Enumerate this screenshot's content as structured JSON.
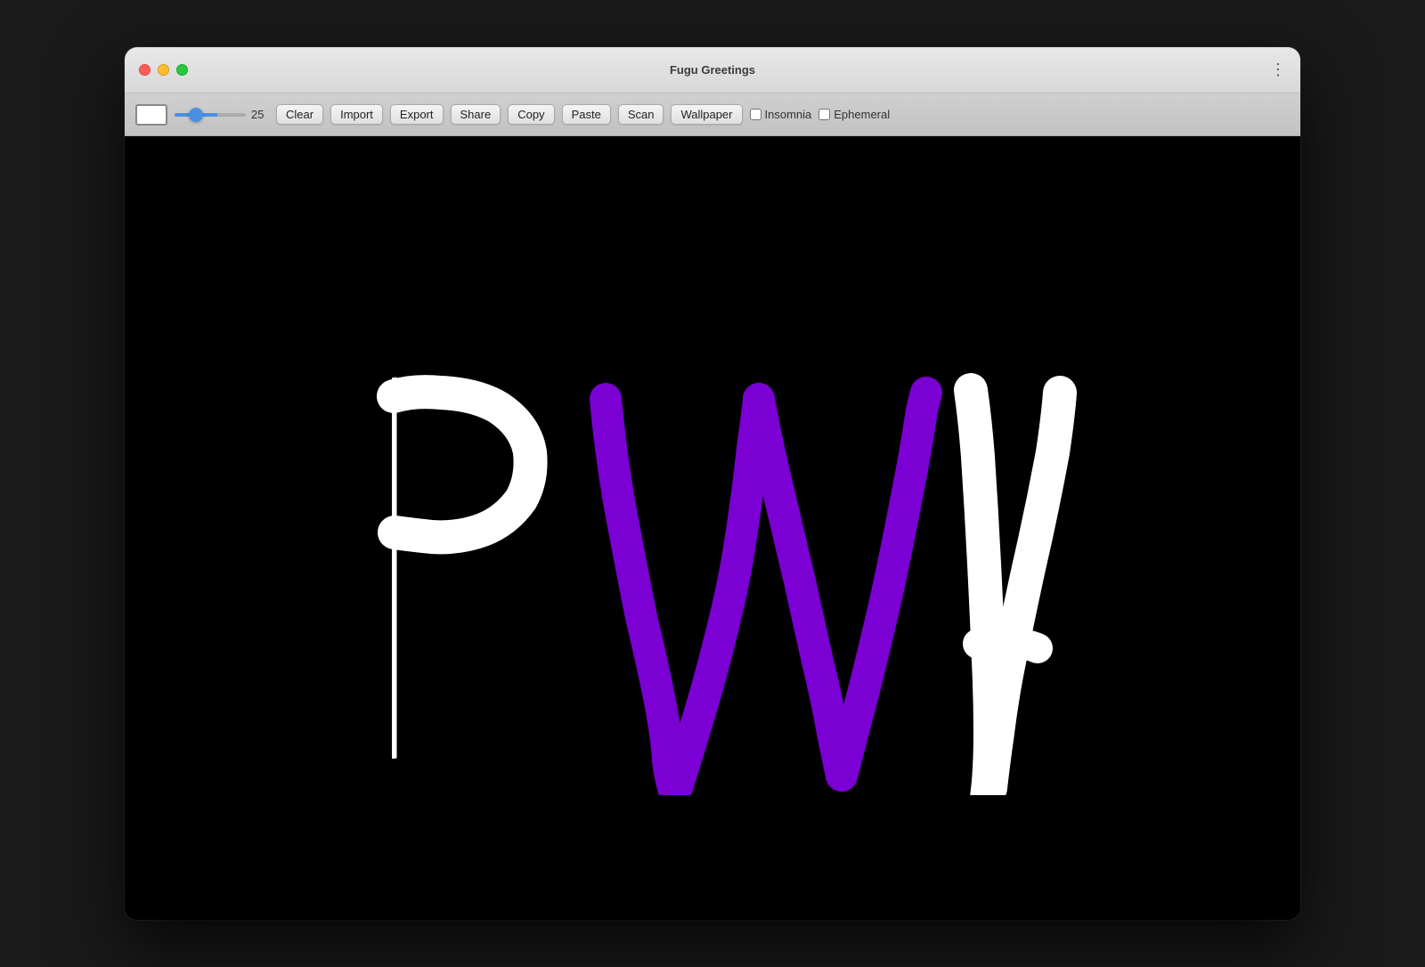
{
  "window": {
    "title": "Fugu Greetings",
    "traffic_lights": {
      "close": "close",
      "minimize": "minimize",
      "maximize": "maximize"
    },
    "menu_icon": "⋮"
  },
  "toolbar": {
    "color_swatch_label": "color-swatch",
    "slider_value": "25",
    "buttons": [
      {
        "id": "clear",
        "label": "Clear"
      },
      {
        "id": "import",
        "label": "Import"
      },
      {
        "id": "export",
        "label": "Export"
      },
      {
        "id": "share",
        "label": "Share"
      },
      {
        "id": "copy",
        "label": "Copy"
      },
      {
        "id": "paste",
        "label": "Paste"
      },
      {
        "id": "scan",
        "label": "Scan"
      },
      {
        "id": "wallpaper",
        "label": "Wallpaper"
      }
    ],
    "checkboxes": [
      {
        "id": "insomnia",
        "label": "Insomnia",
        "checked": false
      },
      {
        "id": "ephemeral",
        "label": "Ephemeral",
        "checked": false
      }
    ]
  },
  "canvas": {
    "background": "#000000",
    "drawing": "PWA letters in white and purple"
  }
}
